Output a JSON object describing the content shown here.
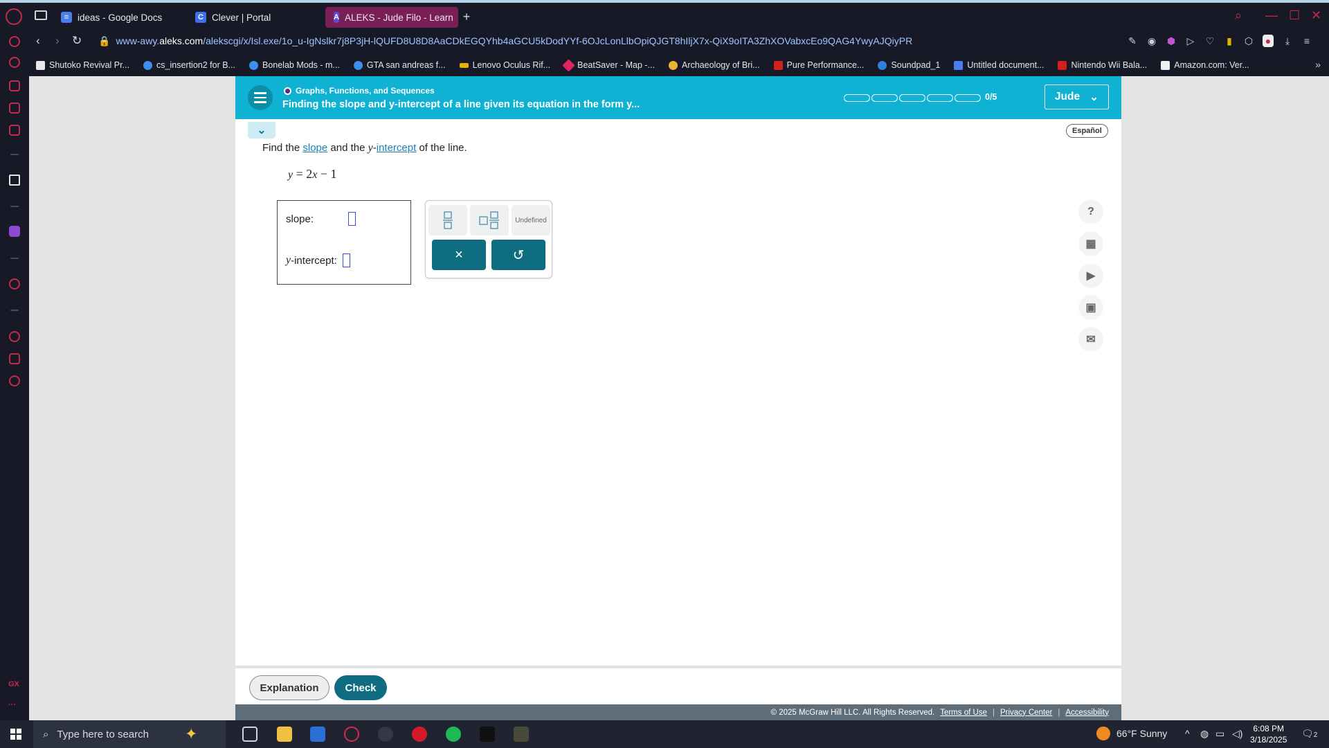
{
  "browser": {
    "tabs": [
      {
        "label": "ideas - Google Docs",
        "icon": "docs-icon",
        "color": "#4a7df2"
      },
      {
        "label": "Clever | Portal",
        "icon": "clever-icon",
        "color": "#3f6ff0"
      },
      {
        "label": "ALEKS - Jude Filo - Learn",
        "icon": "aleks-icon",
        "color": "#5c49d8"
      }
    ],
    "url_prefix": "www-awy.",
    "url_domain": "aleks.com",
    "url_path": "/alekscgi/x/Isl.exe/1o_u-IgNslkr7j8P3jH-lQUFD8U8D8AaCDkEGQYhb4aGCU5kDodYYf-6OJcLonLlbOpiQJGT8hIljX7x-QiX9oITA3ZhXOVabxcEo9QAG4YwyAJQiyPR",
    "bookmarks": [
      {
        "label": "Shutoko Revival Pr...",
        "color": "#e8e8e8"
      },
      {
        "label": "cs_insertion2 for B...",
        "color": "#3e8df0"
      },
      {
        "label": "Bonelab Mods - m...",
        "color": "#3e8df0"
      },
      {
        "label": "GTA san andreas f...",
        "color": "#3e8df0"
      },
      {
        "label": "Lenovo Oculus Rif...",
        "color": "#e0b400"
      },
      {
        "label": "BeatSaver - Map -...",
        "color": "#e0245e"
      },
      {
        "label": "Archaeology of Bri...",
        "color": "#e8b630"
      },
      {
        "label": "Pure Performance...",
        "color": "#d02020"
      },
      {
        "label": "Soundpad_1",
        "color": "#2f7fe0"
      },
      {
        "label": "Untitled document...",
        "color": "#4a7df2"
      },
      {
        "label": "Nintendo Wii Bala...",
        "color": "#d02020"
      },
      {
        "label": "Amazon.com: Ver...",
        "color": "#f0f0f0"
      }
    ]
  },
  "aleks": {
    "breadcrumb": "Graphs, Functions, and Sequences",
    "topic": "Finding the slope and y-intercept of a line given its equation in the form y...",
    "progress_count": "0/5",
    "progress_done": 0,
    "user": "Jude",
    "espanol": "Español",
    "prompt": {
      "part1": "Find the",
      "slope_link": "slope",
      "part2": "and the",
      "y_var": "y",
      "intercept_link": "intercept",
      "part3": "of the line."
    },
    "equation": {
      "lhs": "y",
      "eq": "=",
      "coef": "2",
      "var": "x",
      "op": "−",
      "const": "1"
    },
    "answer": {
      "slope_label": "slope:",
      "y_var": "y",
      "intercept_label": "-intercept:"
    },
    "keypad": {
      "undefined_label": "Undefined",
      "clear_symbol": "×",
      "undo_symbol": "↺"
    },
    "footer": {
      "explanation": "Explanation",
      "check": "Check"
    },
    "legal": {
      "copyright": "© 2025 McGraw Hill LLC. All Rights Reserved.",
      "terms": "Terms of Use",
      "privacy": "Privacy Center",
      "accessibility": "Accessibility"
    }
  },
  "taskbar": {
    "search_placeholder": "Type here to search",
    "weather": "66°F  Sunny",
    "time": "6:08 PM",
    "date": "3/18/2025",
    "notif_count": "2"
  },
  "rail": {
    "gx_label": "GX"
  }
}
